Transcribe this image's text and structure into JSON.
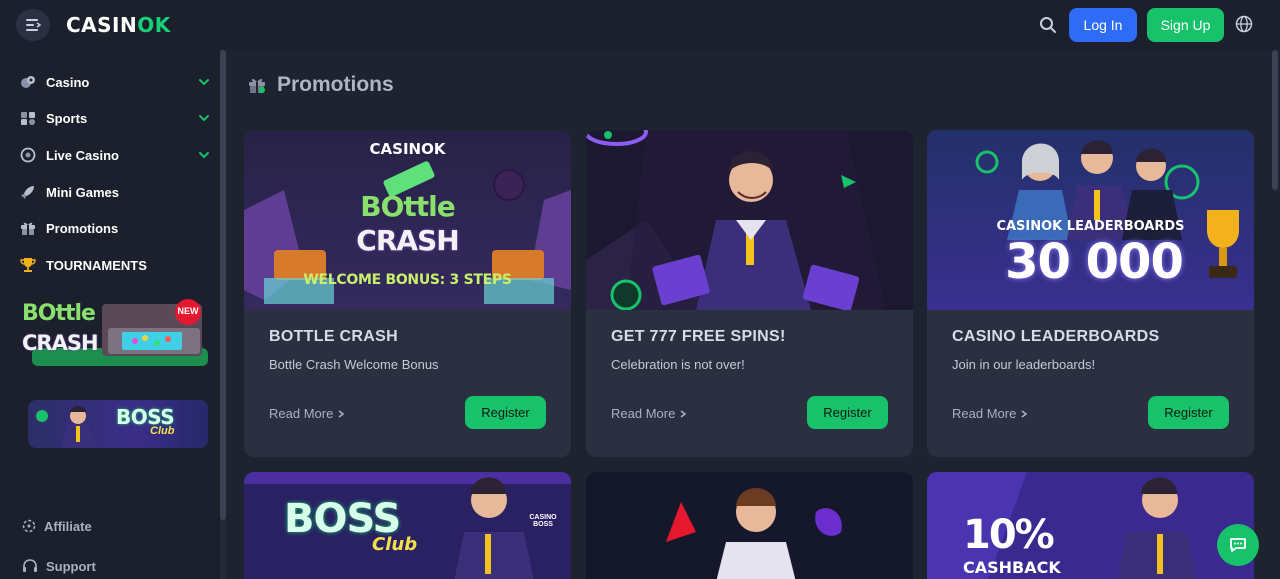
{
  "header": {
    "logo_text": "CASIN",
    "logo_ok": "OK",
    "login_label": "Log In",
    "signup_label": "Sign Up"
  },
  "sidebar": {
    "items": [
      {
        "label": "Casino",
        "icon": "casino-chips-icon",
        "expandable": true
      },
      {
        "label": "Sports",
        "icon": "sports-icon",
        "expandable": true
      },
      {
        "label": "Live Casino",
        "icon": "live-casino-icon",
        "expandable": true
      },
      {
        "label": "Mini Games",
        "icon": "rocket-icon",
        "expandable": false
      },
      {
        "label": "Promotions",
        "icon": "gift-icon",
        "expandable": false
      },
      {
        "label": "TOURNAMENTS",
        "icon": "trophy-icon",
        "expandable": false
      }
    ],
    "banner1": {
      "text_top": "BOttle",
      "text_bottom": "CRASH",
      "badge": "NEW"
    },
    "banner2": {
      "text_top": "BOSS",
      "text_bottom": "Club"
    },
    "footer": [
      {
        "label": "Affiliate",
        "icon": "affiliate-icon"
      },
      {
        "label": "Support",
        "icon": "headset-icon"
      }
    ]
  },
  "main": {
    "title": "Promotions",
    "cards": [
      {
        "title": "BOTTLE CRASH",
        "desc": "Bottle Crash Welcome Bonus",
        "readmore": "Read More",
        "register": "Register",
        "img": {
          "brand": "CASINOK",
          "line1": "BOttle",
          "line2": "CRASH",
          "caption": "WELCOME BONUS: 3 STEPS"
        }
      },
      {
        "title": "GET 777 FREE SPINS!",
        "desc": "Celebration is not over!",
        "readmore": "Read More",
        "register": "Register"
      },
      {
        "title": "CASINO LEADERBOARDS",
        "desc": "Join in our leaderboards!",
        "readmore": "Read More",
        "register": "Register",
        "img": {
          "caption": "CASINOK LEADERBOARDS",
          "amount": "30 000"
        }
      }
    ],
    "cards_row2": [
      {
        "line1": "BOSS",
        "line2": "Club",
        "brand": "CASINO BOSS"
      },
      {},
      {
        "line1": "10%",
        "line2": "CASHBACK"
      }
    ]
  },
  "colors": {
    "accent": "#17c26b",
    "login": "#2f6cf6",
    "bg": "#1e2330",
    "card": "#2a3040"
  }
}
